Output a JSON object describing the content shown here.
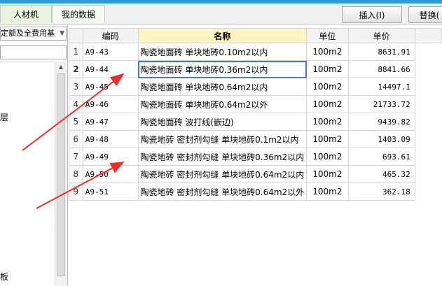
{
  "toolbar": {
    "tabs": [
      "人材机",
      "我的数据"
    ],
    "insert_label": "插入(I)",
    "replace_label": "替换("
  },
  "left_panel": {
    "combo_text": "定额及全费用基",
    "tree_fragments": [
      "层",
      "板"
    ]
  },
  "grid": {
    "headers": [
      "",
      "编码",
      "名称",
      "单位",
      "单价"
    ],
    "rows": [
      {
        "n": "1",
        "code": "A9-43",
        "name": "陶瓷地面砖 单块地砖0.10m2以内",
        "unit": "100m2",
        "price": "8631.91"
      },
      {
        "n": "2",
        "code": "A9-44",
        "name": "陶瓷地面砖 单块地砖0.36m2以内",
        "unit": "100m2",
        "price": "8841.66"
      },
      {
        "n": "3",
        "code": "A9-45",
        "name": "陶瓷地面砖 单块地砖0.64m2以内",
        "unit": "100m2",
        "price": "14497.1"
      },
      {
        "n": "4",
        "code": "A9-46",
        "name": "陶瓷地面砖 单块地砖0.64m2以外",
        "unit": "100m2",
        "price": "21733.72"
      },
      {
        "n": "5",
        "code": "A9-47",
        "name": "陶瓷地面砖 波打线(嵌边)",
        "unit": "100m2",
        "price": "9439.82"
      },
      {
        "n": "6",
        "code": "A9-48",
        "name": "陶瓷地砖 密封剂勾缝 单块地砖0.1m2以内",
        "unit": "100m2",
        "price": "1403.09"
      },
      {
        "n": "7",
        "code": "A9-49",
        "name": "陶瓷地砖 密封剂勾缝 单块地砖0.36m2以内",
        "unit": "100m2",
        "price": "693.61"
      },
      {
        "n": "8",
        "code": "A9-50",
        "name": "陶瓷地砖 密封剂勾缝 单块地砖0.64m2以内",
        "unit": "100m2",
        "price": "465.32"
      },
      {
        "n": "9",
        "code": "A9-51",
        "name": "陶瓷地砖 密封剂勾缝 单块地砖0.64m2以外",
        "unit": "100m2",
        "price": "362.18"
      }
    ],
    "selected_row": 2
  },
  "colors": {
    "accent": "#2e9bd6",
    "annotation_arrow": "#e8302b",
    "header_highlight": "#fff4c2"
  }
}
